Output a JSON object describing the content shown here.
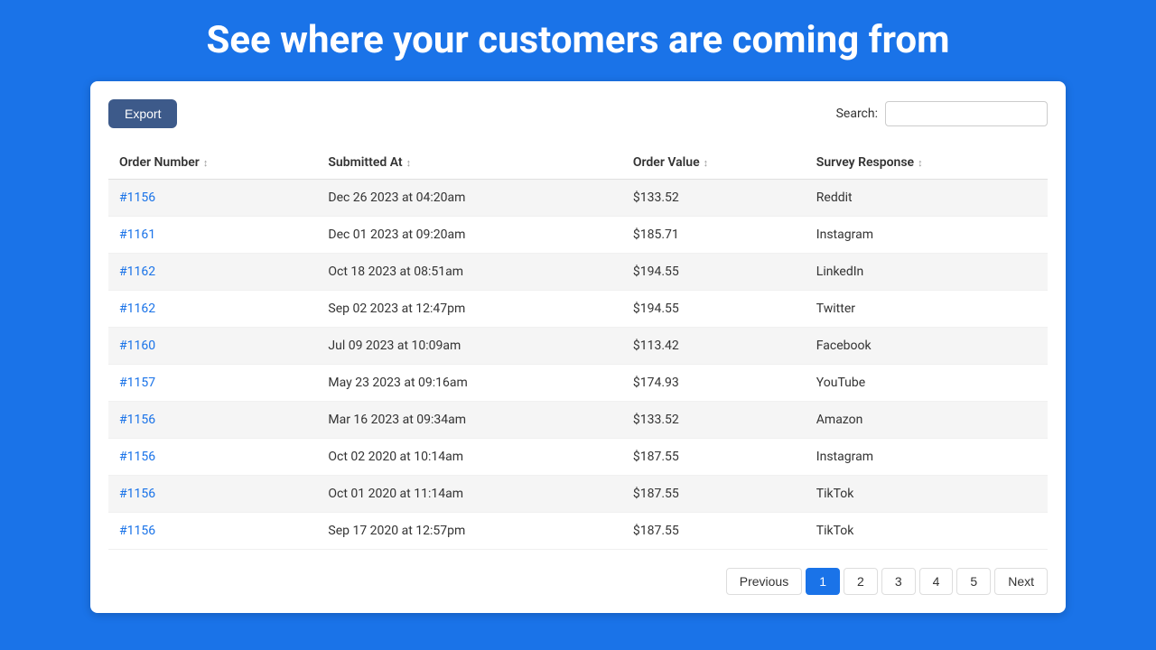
{
  "header": {
    "title": "See where your customers are coming from"
  },
  "toolbar": {
    "export_label": "Export",
    "search_label": "Search:",
    "search_placeholder": ""
  },
  "table": {
    "columns": [
      {
        "id": "order_number",
        "label": "Order Number",
        "sortable": true
      },
      {
        "id": "submitted_at",
        "label": "Submitted At",
        "sortable": true
      },
      {
        "id": "order_value",
        "label": "Order Value",
        "sortable": true
      },
      {
        "id": "survey_response",
        "label": "Survey Response",
        "sortable": true
      }
    ],
    "rows": [
      {
        "order_number": "#1156",
        "submitted_at": "Dec 26 2023 at 04:20am",
        "order_value": "$133.52",
        "survey_response": "Reddit"
      },
      {
        "order_number": "#1161",
        "submitted_at": "Dec 01 2023 at 09:20am",
        "order_value": "$185.71",
        "survey_response": "Instagram"
      },
      {
        "order_number": "#1162",
        "submitted_at": "Oct 18 2023 at 08:51am",
        "order_value": "$194.55",
        "survey_response": "LinkedIn"
      },
      {
        "order_number": "#1162",
        "submitted_at": "Sep 02 2023 at 12:47pm",
        "order_value": "$194.55",
        "survey_response": "Twitter"
      },
      {
        "order_number": "#1160",
        "submitted_at": "Jul 09 2023 at 10:09am",
        "order_value": "$113.42",
        "survey_response": "Facebook"
      },
      {
        "order_number": "#1157",
        "submitted_at": "May 23 2023 at 09:16am",
        "order_value": "$174.93",
        "survey_response": "YouTube"
      },
      {
        "order_number": "#1156",
        "submitted_at": "Mar 16 2023 at 09:34am",
        "order_value": "$133.52",
        "survey_response": "Amazon"
      },
      {
        "order_number": "#1156",
        "submitted_at": "Oct 02 2020 at 10:14am",
        "order_value": "$187.55",
        "survey_response": "Instagram"
      },
      {
        "order_number": "#1156",
        "submitted_at": "Oct 01 2020 at 11:14am",
        "order_value": "$187.55",
        "survey_response": "TikTok"
      },
      {
        "order_number": "#1156",
        "submitted_at": "Sep 17 2020 at 12:57pm",
        "order_value": "$187.55",
        "survey_response": "TikTok"
      }
    ]
  },
  "pagination": {
    "previous_label": "Previous",
    "next_label": "Next",
    "pages": [
      "1",
      "2",
      "3",
      "4",
      "5"
    ],
    "active_page": "1"
  }
}
